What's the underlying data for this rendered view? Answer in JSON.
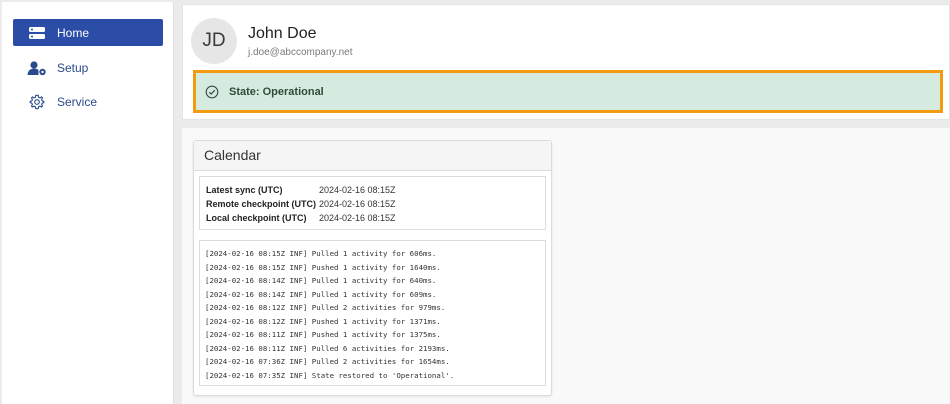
{
  "sidebar": {
    "items": [
      {
        "label": "Home",
        "icon": "home-server-icon",
        "active": true
      },
      {
        "label": "Setup",
        "icon": "user-settings-icon",
        "active": false
      },
      {
        "label": "Service",
        "icon": "gear-icon",
        "active": false
      }
    ]
  },
  "user": {
    "initials": "JD",
    "name": "John Doe",
    "email": "j.doe@abccompany.net"
  },
  "status": {
    "text": "State: Operational",
    "icon": "check-circle-icon",
    "highlight_color": "#f39c12"
  },
  "calendar": {
    "title": "Calendar",
    "sync": [
      {
        "label": "Latest sync (UTC)",
        "value": "2024-02-16 08:15Z"
      },
      {
        "label": "Remote checkpoint (UTC)",
        "value": "2024-02-16 08:15Z"
      },
      {
        "label": "Local checkpoint (UTC)",
        "value": "2024-02-16 08:15Z"
      }
    ],
    "log": [
      "[2024-02-16 08:15Z INF] Pulled 1 activity for 606ms.",
      "[2024-02-16 08:15Z INF] Pushed 1 activity for 1640ms.",
      "[2024-02-16 08:14Z INF] Pulled 1 activity for 640ms.",
      "[2024-02-16 08:14Z INF] Pulled 1 activity for 609ms.",
      "[2024-02-16 08:12Z INF] Pulled 2 activities for 979ms.",
      "[2024-02-16 08:12Z INF] Pushed 1 activity for 1371ms.",
      "[2024-02-16 08:11Z INF] Pushed 1 activity for 1375ms.",
      "[2024-02-16 08:11Z INF] Pulled 6 activities for 2193ms.",
      "[2024-02-16 07:36Z INF] Pulled 2 activities for 1654ms.",
      "[2024-02-16 07:35Z INF] State restored to 'Operational'."
    ]
  }
}
